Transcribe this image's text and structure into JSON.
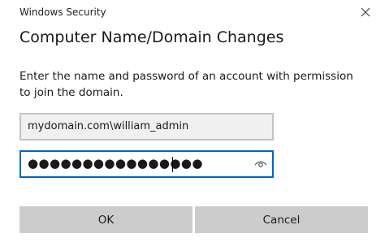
{
  "window": {
    "title": "Windows Security",
    "close_icon": "close-icon"
  },
  "dialog": {
    "heading": "Computer Name/Domain Changes",
    "instructions": "Enter the name and password of an account with permission to join the domain."
  },
  "form": {
    "username_value": "mydomain.com\\william_admin",
    "password_masked": "●●●●●●●●●●●●●●●●",
    "reveal_icon": "eye-icon"
  },
  "buttons": {
    "ok_label": "OK",
    "cancel_label": "Cancel"
  },
  "colors": {
    "focus_border": "#0067c0",
    "button_bg": "#cccccc",
    "field_bg": "#f0f0f0"
  }
}
